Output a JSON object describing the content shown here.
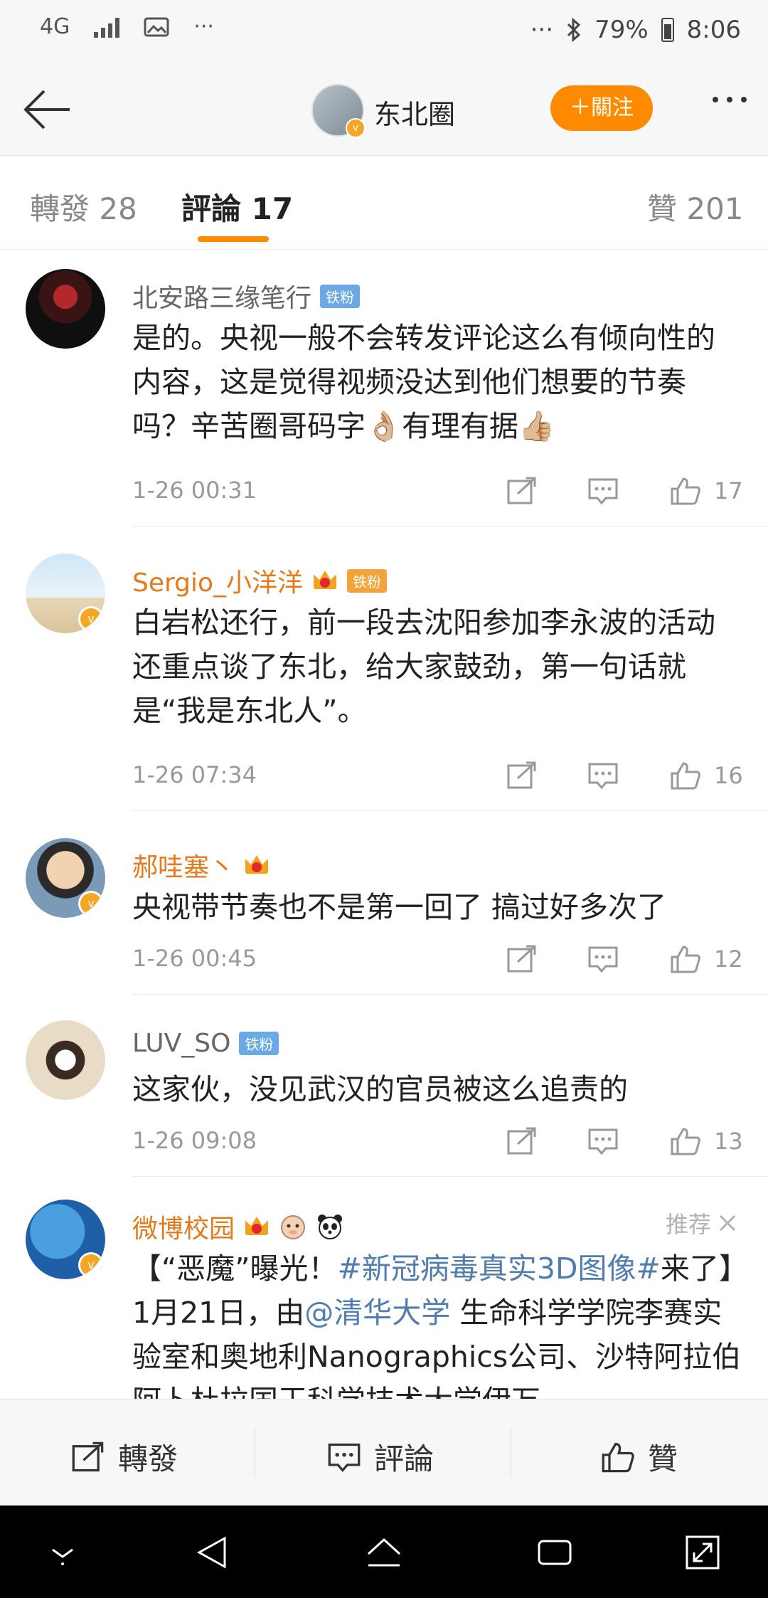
{
  "status_bar": {
    "network": "4G",
    "left_more": "···",
    "right_more": "···",
    "battery": "79%",
    "time": "8:06"
  },
  "header": {
    "title": "东北圈",
    "follow_label": "＋關注"
  },
  "tabs": [
    {
      "label": "轉發 28"
    },
    {
      "label": "評論 17"
    },
    {
      "label": "贊 201"
    }
  ],
  "comments": [
    {
      "user": "北安路三缘笔行",
      "badge": "铁粉",
      "text": "是的。央视一般不会转发评论这么有倾向性的内容，这是觉得视频没达到他们想要的节奏吗？辛苦圈哥码字👌🏼有理有据👍🏼",
      "time": "1-26 00:31",
      "likes": "17"
    },
    {
      "user": "Sergio_小洋洋",
      "badge": "铁粉",
      "text": "白岩松还行，前一段去沈阳参加李永波的活动还重点谈了东北，给大家鼓劲，第一句话就是“我是东北人”。",
      "time": "1-26 07:34",
      "likes": "16"
    },
    {
      "user": "郝哇塞丶",
      "text": "央视带节奏也不是第一回了  搞过好多次了",
      "time": "1-26 00:45",
      "likes": "12"
    },
    {
      "user": "LUV_SO",
      "badge": "铁粉",
      "text": "这家伙，没见武汉的官员被这么追责的",
      "time": "1-26 09:08",
      "likes": "13"
    },
    {
      "user": "微博校园",
      "recommend": "推荐",
      "text_prefix": "【“恶魔”曝光！",
      "hashtag": "#新冠病毒真实3D图像#",
      "text_mid": "来了】1月21日，由",
      "mention": "@清华大学",
      "text_suffix": " 生命科学学院李赛实验室和奥地利Nanographics公司、沙特阿拉伯阿卜杜拉国王科学技术大学伊万"
    }
  ],
  "bottom_bar": {
    "repost": "轉發",
    "comment": "評論",
    "like": "贊"
  },
  "colors": {
    "accent": "#ff8a00",
    "link": "#507daf",
    "username_orange": "#e8791a"
  }
}
